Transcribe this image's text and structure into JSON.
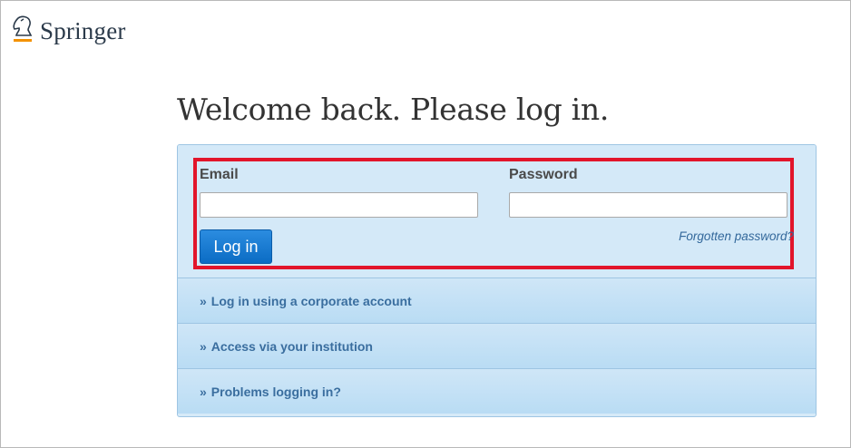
{
  "brand": {
    "name": "Springer",
    "logo_icon": "springer-horse-icon",
    "accent": "#f39200"
  },
  "page": {
    "title": "Welcome back. Please log in."
  },
  "login": {
    "email_label": "Email",
    "email_value": "",
    "password_label": "Password",
    "password_value": "",
    "forgot_label": "Forgotten password?",
    "submit_label": "Log in"
  },
  "links": [
    {
      "prefix": "»",
      "label": "Log in using a corporate account"
    },
    {
      "prefix": "»",
      "label": "Access via your institution"
    },
    {
      "prefix": "»",
      "label": "Problems logging in?"
    }
  ],
  "colors": {
    "highlight_border": "#e2152b",
    "button": "#0b6cc4",
    "panel": "#d4e9f8",
    "link_text": "#3a6e9f"
  }
}
